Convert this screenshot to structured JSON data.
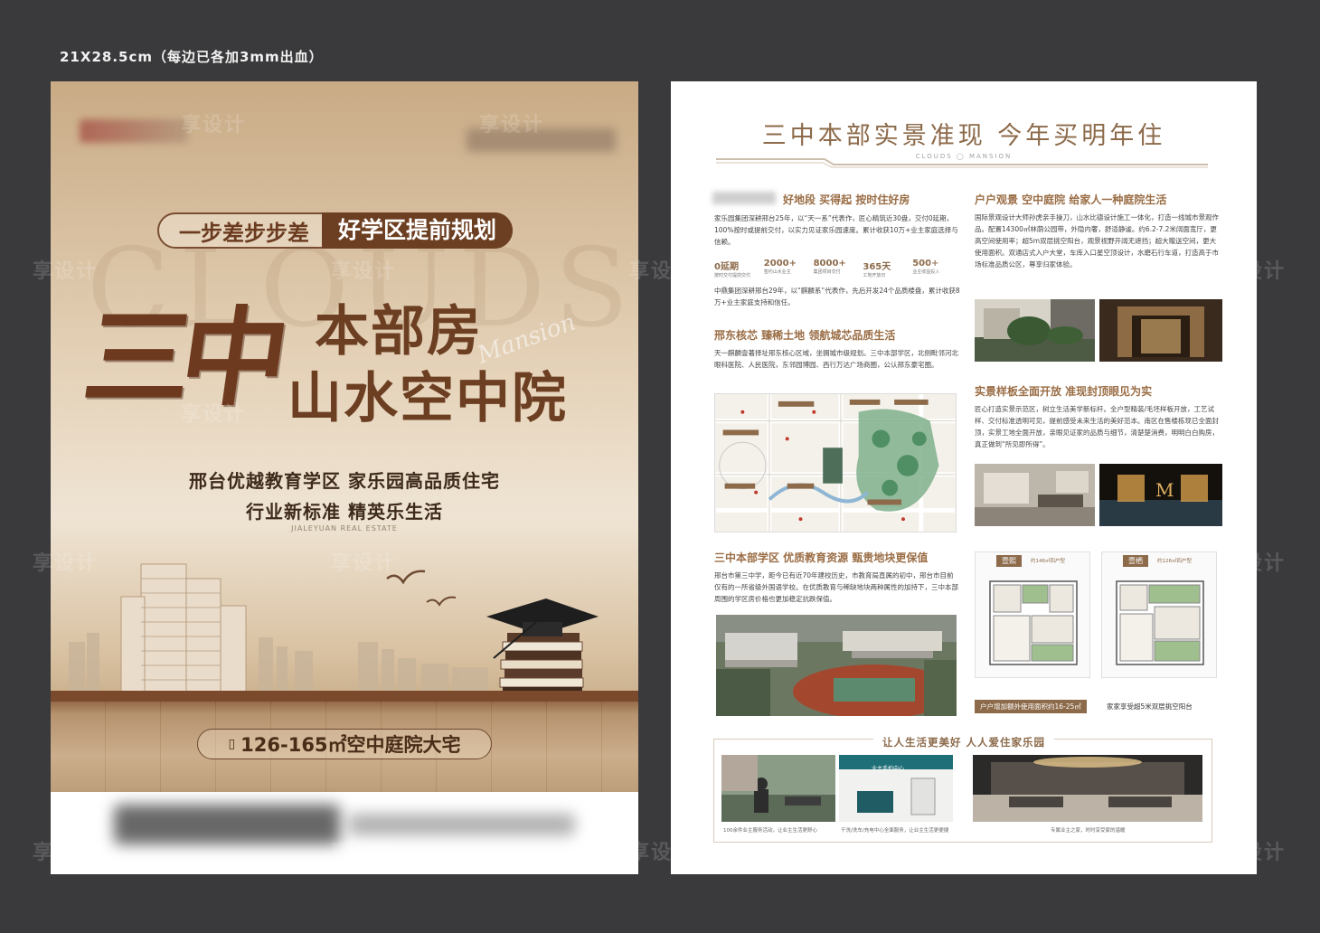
{
  "spec_label": "21X28.5cm（每边已各加3mm出血）",
  "watermark": "享设计",
  "front": {
    "bg_word": "CLOUDS",
    "script_word": "Mansion",
    "tagline_left": "一步差步步差",
    "tagline_right": "好学区提前规划",
    "brush_title": "三中",
    "headline_1": "本部房",
    "headline_2": "山水空中院",
    "subtitle_1": "邢台优越教育学区 家乐园高品质住宅",
    "subtitle_2": "行业新标准 精英乐生活",
    "brand_small": "JIALEYUAN REAL ESTATE",
    "size_icon": "ruler-icon",
    "size_text": "126-165㎡空中庭院大宅"
  },
  "back": {
    "title": "三中本部实景准现 今年买明年住",
    "clouds_mark": "CLOUDS ◯ MANSION",
    "s1": {
      "heading": "好地段 买得起 按时住好房",
      "p1": "家乐园集团深耕邢台25年，以“天一系”代表作，匠心精筑近30盘，交付0延期，100%按时或提前交付，以实力见证家乐园速度。累计收获10万+业主家庭选择与信赖。",
      "stats": [
        {
          "v": "0延期",
          "l": "按时交付提前交付"
        },
        {
          "v": "2000+",
          "l": "签约山水业主"
        },
        {
          "v": "8000+",
          "l": "集团项目交付"
        },
        {
          "v": "365天",
          "l": "工地开放日"
        },
        {
          "v": "500+",
          "l": "业主收益投入"
        }
      ],
      "p2": "中鼎集团深耕邢台29年，以“麒麟系”代表作，先后开发24个品质楼盘，累计收获8万+业主家庭支持和信任。"
    },
    "s2": {
      "heading": "邢东核芯 臻稀土地 领航城芯品质生活",
      "p": "天一麒麟壹著择址邢东核心区域，坐拥城市级规划。三中本部学区，北侧毗邻河北眼科医院、人民医院，东邻园博园、西行万达广场商圈，公认邢东豪宅圈。"
    },
    "s3": {
      "heading": "三中本部学区 优质教育资源 甄贵地块更保值",
      "p": "邢台市第三中学，距今已有近70年建校历史，市教育局直属的初中，邢台市目前仅有的一所省级外国语学校。在优质教育与稀缺地块两种属性的加持下，三中本部周围的学区房价格也更加稳定抗跌保值。"
    },
    "s4": {
      "heading": "户户观景 空中庭院 给家人一种庭院生活",
      "p": "国际景观设计大师孙虎亲手操刀，山水比德设计施工一体化，打造一线城市景观作品。配置14300㎡林荫公园带，外隐内奢，舒适静谧。约6.2-7.2米阔面宽厅，更高空间使用率；超5m双层挑空阳台，观景视野开阔无遮挡；超大赠送空间，更大使用面积。双通店式入户大堂，车库入口星空顶设计，水磨石行车道，打造高于市场标准品质公区，尊享归家体验。"
    },
    "s5": {
      "heading": "实景样板全面开放 准现封顶眼见为实",
      "p": "匠心打造实景示范区，树立生活美学新标杆。全户型精装/毛坯样板开放，工艺试样、交付标准透明可见，提前感受未来生活的美好范本。南区在售楼栋现已全面封顶，实景工地全面开放，亲眼见证家的品质与细节，清楚楚消费，明明白白购房，真正做到“所见即所得”。"
    },
    "plans": {
      "a_name": "壹熙",
      "a_area": "约146㎡四户型",
      "b_name": "壹栖",
      "b_area": "约126㎡四户型",
      "bar_1": "户户增加额外使用面积约16-25㎡",
      "bar_2": "家家享受超5米双层挑空阳台"
    },
    "footer": {
      "heading": "让人生活更美好 人人爱住家乐园",
      "sign": "业主手拍中心",
      "cap_1": "100余件业主服务活动，让业主生活更舒心",
      "cap_2": "干洗/洗车/充电中心全面服务，让业主生活更便捷",
      "cap_3": "专属业主之家，时时享受家的温暖"
    }
  }
}
